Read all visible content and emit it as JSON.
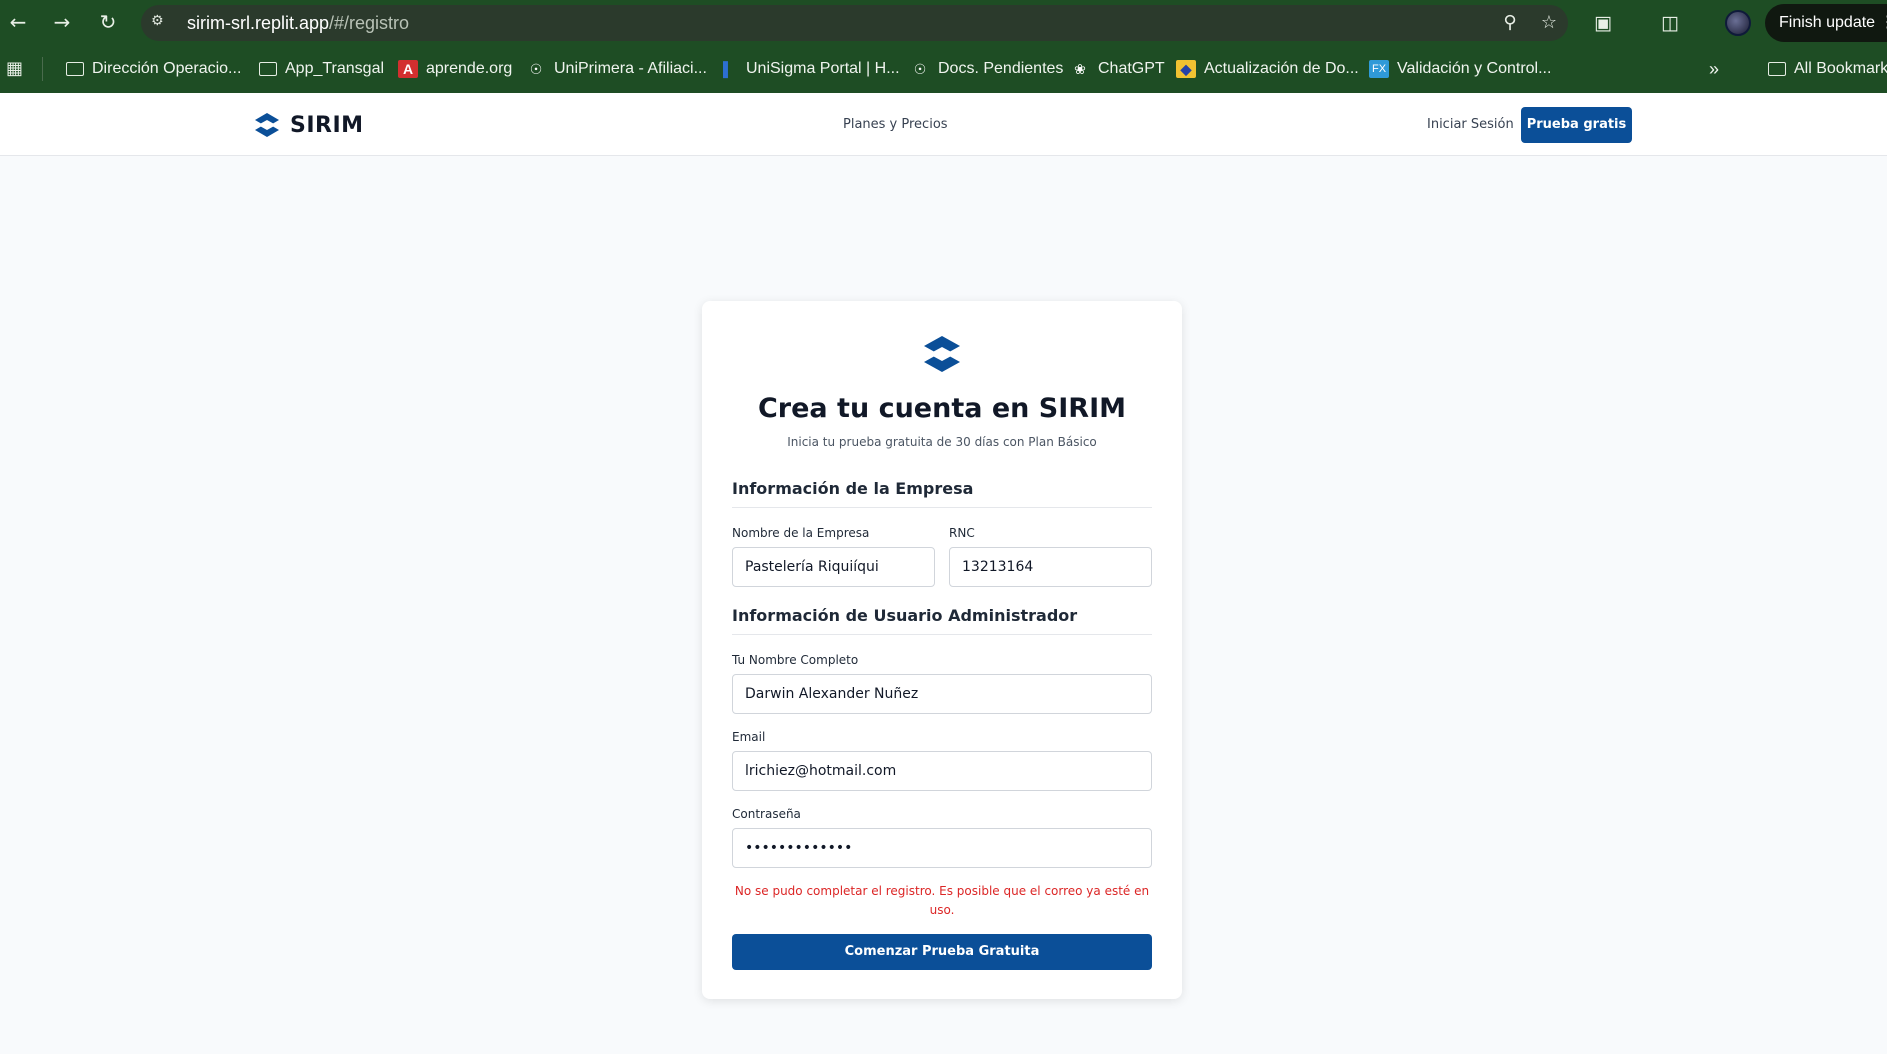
{
  "browser": {
    "url_host": "sirim-srl.replit.app",
    "url_path": "/#/registro",
    "finish_update_label": "Finish update",
    "bookmarks": [
      {
        "label": "Dirección Operacio...",
        "icon": "folder-icon"
      },
      {
        "label": "App_Transgal",
        "icon": "folder-icon"
      },
      {
        "label": "aprende.org",
        "icon": "aprende-icon"
      },
      {
        "label": "UniPrimera - Afiliaci...",
        "icon": "globe-icon"
      },
      {
        "label": "UniSigma Portal | H...",
        "icon": "unisigma-icon"
      },
      {
        "label": "Docs. Pendientes",
        "icon": "globe-icon"
      },
      {
        "label": "ChatGPT",
        "icon": "chatgpt-icon"
      },
      {
        "label": "Actualización de Do...",
        "icon": "ad-icon"
      },
      {
        "label": "Validación y Control...",
        "icon": "validation-icon"
      }
    ],
    "all_bookmarks_label": "All Bookmark"
  },
  "header": {
    "brand": "SIRIM",
    "nav_pricing": "Planes y Precios",
    "login": "Iniciar Sesión",
    "trial_button": "Prueba gratis"
  },
  "form": {
    "title": "Crea tu cuenta en SIRIM",
    "subtitle": "Inicia tu prueba gratuita de 30 días con Plan Básico",
    "company_section": "Información de la Empresa",
    "company_name_label": "Nombre de la Empresa",
    "company_name_value": "Pastelería Riquiíqui",
    "rnc_label": "RNC",
    "rnc_value": "13213164",
    "admin_section": "Información de Usuario Administrador",
    "full_name_label": "Tu Nombre Completo",
    "full_name_value": "Darwin Alexander Nuñez",
    "email_label": "Email",
    "email_value": "lrichiez@hotmail.com",
    "password_label": "Contraseña",
    "password_value": "•••••••••••••",
    "error": "No se pudo completar el registro. Es posible que el correo ya esté en uso.",
    "submit": "Comenzar Prueba Gratuita"
  },
  "colors": {
    "browser_frame": "#1e4d24",
    "primary": "#0b4f98",
    "error": "#dc2626",
    "page_bg": "#f8fafc"
  }
}
